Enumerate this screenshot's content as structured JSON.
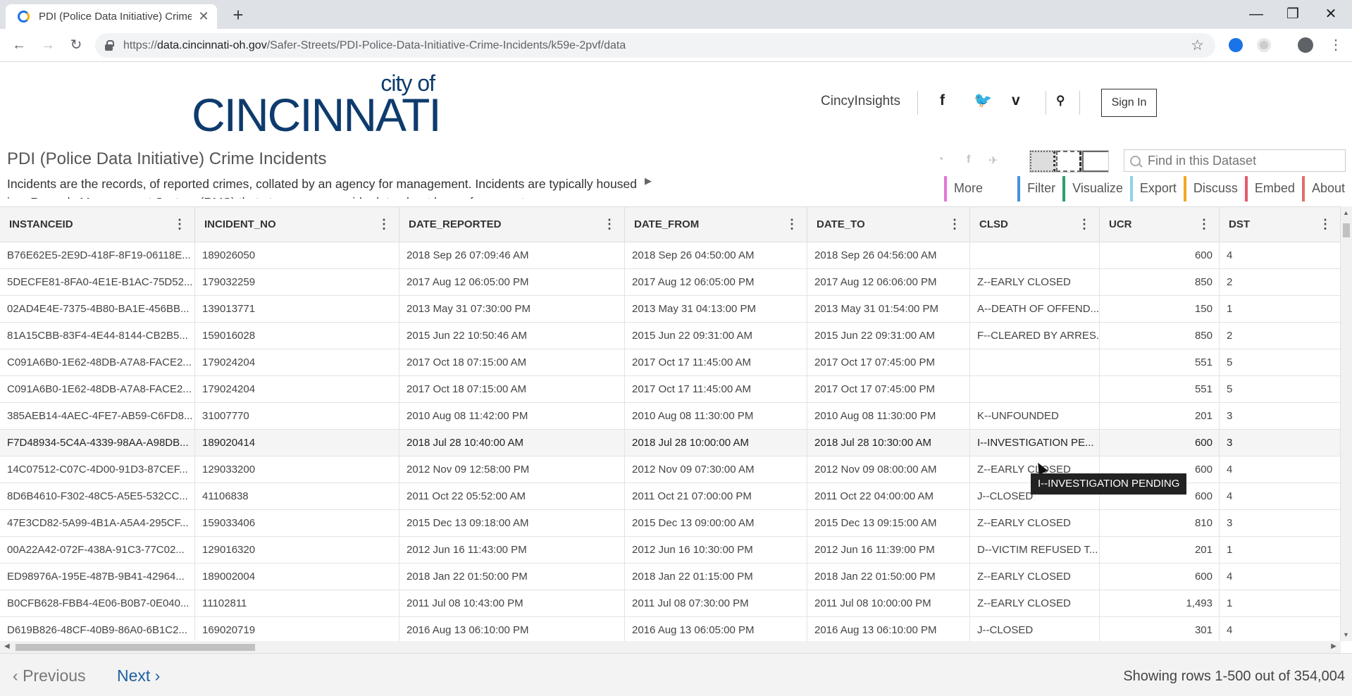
{
  "browser": {
    "tab_title": "PDI (Police Data Initiative) Crime",
    "url_scheme": "https://",
    "url_host": "data.cincinnati-oh.gov",
    "url_path": "/Safer-Streets/PDI-Police-Data-Initiative-Crime-Incidents/k59e-2pvf/data"
  },
  "site": {
    "logo_cityof": "city of",
    "logo_name": "CINCINNATI",
    "nav_link": "CincyInsights",
    "sign_in": "Sign In",
    "social": [
      "facebook-icon",
      "twitter-icon",
      "vimeo-icon",
      "search-icon"
    ]
  },
  "dataset": {
    "title": "PDI (Police Data Initiative) Crime Incidents",
    "description": "Incidents are the records, of reported crimes, collated by an agency for management. Incidents are typically housed in a Records Management System (RMS) that stores agency-wide data about law enforcement",
    "find_placeholder": "Find in this Dataset",
    "actions": [
      {
        "label": "More Views",
        "color": "#e376d6"
      },
      {
        "label": "Filter",
        "color": "#4a90d9"
      },
      {
        "label": "Visualize",
        "color": "#2e9e6e"
      },
      {
        "label": "Export",
        "color": "#8cd4e8"
      },
      {
        "label": "Discuss",
        "color": "#f5a623"
      },
      {
        "label": "Embed",
        "color": "#e35b6d"
      },
      {
        "label": "About",
        "color": "#e36b6b"
      }
    ]
  },
  "grid": {
    "columns": [
      "INSTANCEID",
      "INCIDENT_NO",
      "DATE_REPORTED",
      "DATE_FROM",
      "DATE_TO",
      "CLSD",
      "UCR",
      "DST"
    ],
    "rows": [
      [
        "B76E62E5-2E9D-418F-8F19-06118E...",
        "189026050",
        "2018 Sep 26 07:09:46 AM",
        "2018 Sep 26 04:50:00 AM",
        "2018 Sep 26 04:56:00 AM",
        "",
        "600",
        "4"
      ],
      [
        "5DECFE81-8FA0-4E1E-B1AC-75D52...",
        "179032259",
        "2017 Aug 12 06:05:00 PM",
        "2017 Aug 12 06:05:00 PM",
        "2017 Aug 12 06:06:00 PM",
        "Z--EARLY CLOSED",
        "850",
        "2"
      ],
      [
        "02AD4E4E-7375-4B80-BA1E-456BB...",
        "139013771",
        "2013 May 31 07:30:00 PM",
        "2013 May 31 04:13:00 PM",
        "2013 May 31 01:54:00 PM",
        "A--DEATH OF OFFEND...",
        "150",
        "1"
      ],
      [
        "81A15CBB-83F4-4E44-8144-CB2B5...",
        "159016028",
        "2015 Jun 22 10:50:46 AM",
        "2015 Jun 22 09:31:00 AM",
        "2015 Jun 22 09:31:00 AM",
        "F--CLEARED BY ARRES...",
        "850",
        "2"
      ],
      [
        "C091A6B0-1E62-48DB-A7A8-FACE2...",
        "179024204",
        "2017 Oct 18 07:15:00 AM",
        "2017 Oct 17 11:45:00 AM",
        "2017 Oct 17 07:45:00 PM",
        "",
        "551",
        "5"
      ],
      [
        "C091A6B0-1E62-48DB-A7A8-FACE2...",
        "179024204",
        "2017 Oct 18 07:15:00 AM",
        "2017 Oct 17 11:45:00 AM",
        "2017 Oct 17 07:45:00 PM",
        "",
        "551",
        "5"
      ],
      [
        "385AEB14-4AEC-4FE7-AB59-C6FD8...",
        "31007770",
        "2010 Aug 08 11:42:00 PM",
        "2010 Aug 08 11:30:00 PM",
        "2010 Aug 08 11:30:00 PM",
        "K--UNFOUNDED",
        "201",
        "3"
      ],
      [
        "F7D48934-5C4A-4339-98AA-A98DB...",
        "189020414",
        "2018 Jul 28 10:40:00 AM",
        "2018 Jul 28 10:00:00 AM",
        "2018 Jul 28 10:30:00 AM",
        "I--INVESTIGATION PE...",
        "600",
        "3"
      ],
      [
        "14C07512-C07C-4D00-91D3-87CEF...",
        "129033200",
        "2012 Nov 09 12:58:00 PM",
        "2012 Nov 09 07:30:00 AM",
        "2012 Nov 09 08:00:00 AM",
        "Z--EARLY CLOSED",
        "600",
        "4"
      ],
      [
        "8D6B4610-F302-48C5-A5E5-532CC...",
        "41106838",
        "2011 Oct 22 05:52:00 AM",
        "2011 Oct 21 07:00:00 PM",
        "2011 Oct 22 04:00:00 AM",
        "J--CLOSED",
        "600",
        "4"
      ],
      [
        "47E3CD82-5A99-4B1A-A5A4-295CF...",
        "159033406",
        "2015 Dec 13 09:18:00 AM",
        "2015 Dec 13 09:00:00 AM",
        "2015 Dec 13 09:15:00 AM",
        "Z--EARLY CLOSED",
        "810",
        "3"
      ],
      [
        "00A22A42-072F-438A-91C3-77C02...",
        "129016320",
        "2012 Jun 16 11:43:00 PM",
        "2012 Jun 16 10:30:00 PM",
        "2012 Jun 16 11:39:00 PM",
        "D--VICTIM REFUSED T...",
        "201",
        "1"
      ],
      [
        "ED98976A-195E-487B-9B41-42964...",
        "189002004",
        "2018 Jan 22 01:50:00 PM",
        "2018 Jan 22 01:15:00 PM",
        "2018 Jan 22 01:50:00 PM",
        "Z--EARLY CLOSED",
        "600",
        "4"
      ],
      [
        "B0CFB628-FBB4-4E06-B0B7-0E040...",
        "11102811",
        "2011 Jul 08 10:43:00 PM",
        "2011 Jul 08 07:30:00 PM",
        "2011 Jul 08 10:00:00 PM",
        "Z--EARLY CLOSED",
        "1,493",
        "1"
      ],
      [
        "D619B826-48CF-40B9-86A0-6B1C2...",
        "169020719",
        "2016 Aug 13 06:10:00 PM",
        "2016 Aug 13 06:05:00 PM",
        "2016 Aug 13 06:10:00 PM",
        "J--CLOSED",
        "301",
        "4"
      ]
    ],
    "highlighted_row": 7,
    "tooltip": "I--INVESTIGATION PENDING"
  },
  "footer": {
    "previous": "Previous",
    "next": "Next",
    "row_count": "Showing rows 1-500 out of 354,004"
  }
}
